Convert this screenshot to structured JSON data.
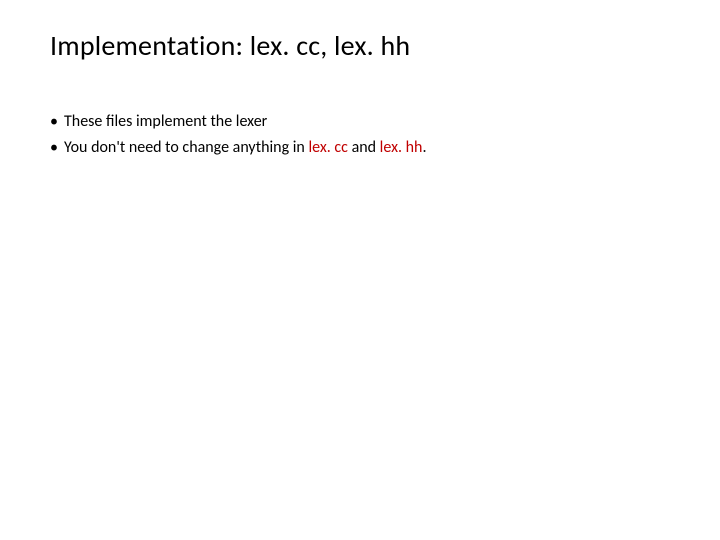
{
  "title": "Implementation: lex. cc, lex. hh",
  "bullets": [
    {
      "text": "These files implement the lexer"
    },
    {
      "prefix": "You don't need to change anything in ",
      "em1": "lex. cc",
      "mid": " and ",
      "em2": "lex. hh",
      "suffix": "."
    }
  ]
}
